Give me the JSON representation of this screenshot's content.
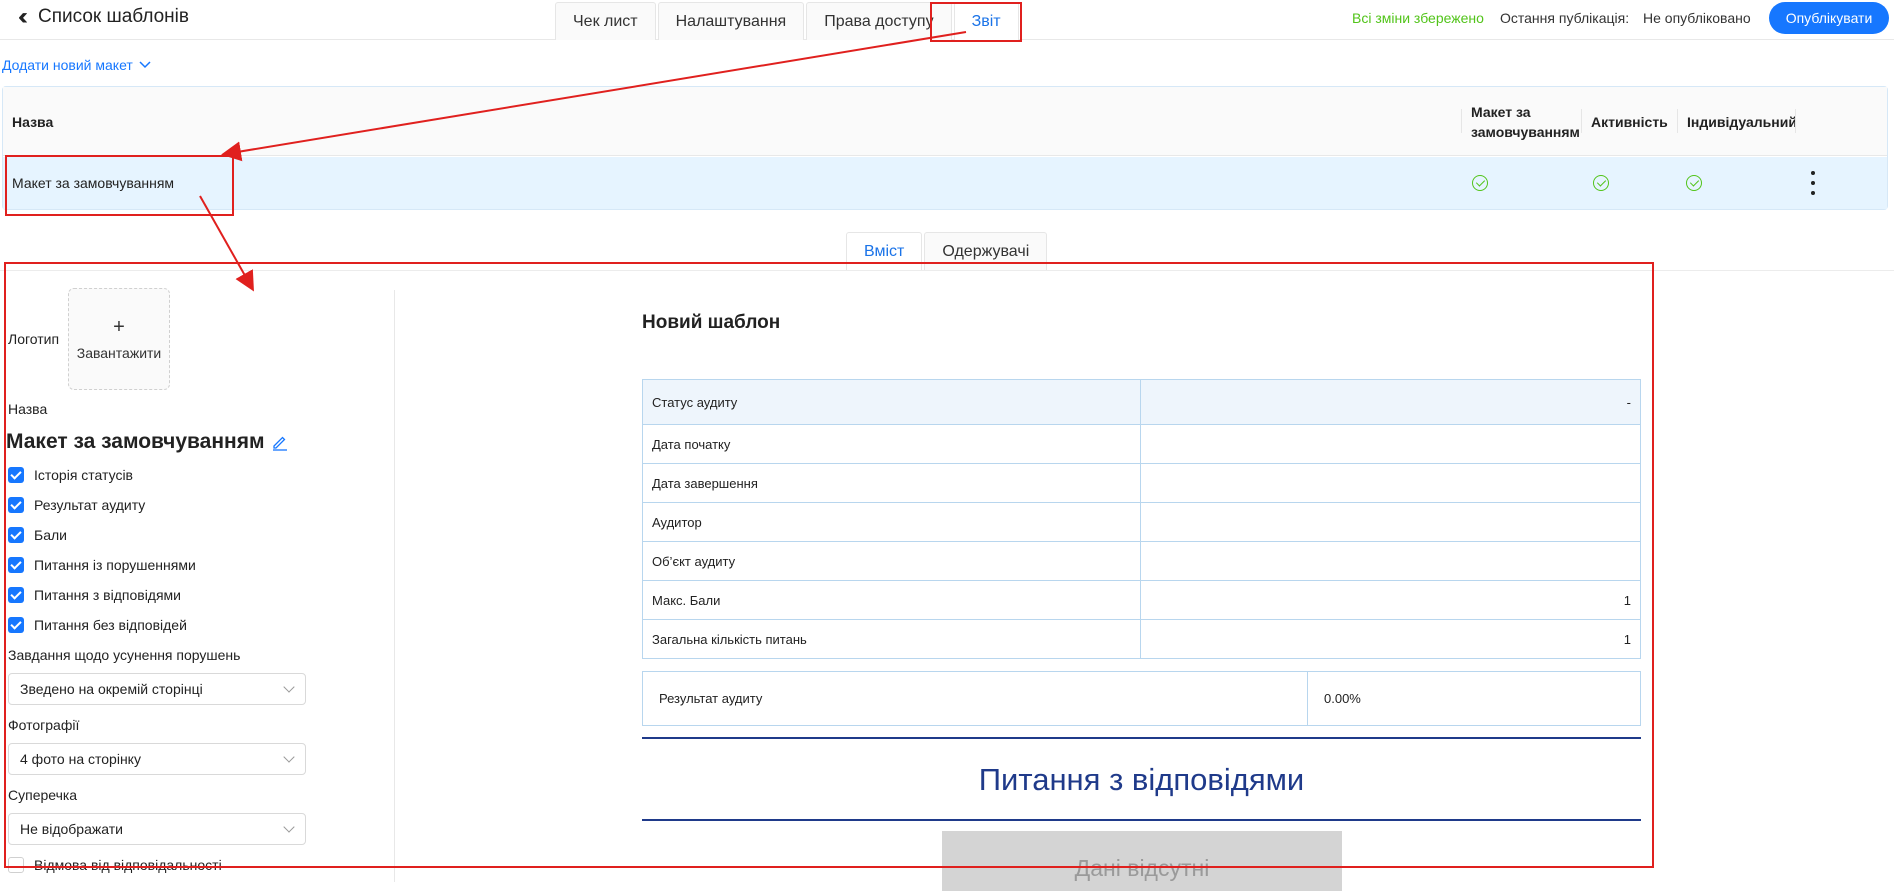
{
  "header": {
    "back_label": "Список шаблонів",
    "tabs": [
      {
        "label": "Чек лист"
      },
      {
        "label": "Налаштування"
      },
      {
        "label": "Права доступу"
      },
      {
        "label": "Звіт"
      }
    ],
    "saved_status": "Всі зміни збережено",
    "last_publication_label": "Остання публікація:",
    "last_publication_value": "Не опубліковано",
    "publish_button": "Опублікувати"
  },
  "add_layout": "Додати новий макет",
  "layouts_table": {
    "columns": [
      "Назва",
      "Макет за замовчуванням",
      "Активність",
      "Індивідуальний"
    ],
    "rows": [
      {
        "name": "Макет за замовчуванням",
        "default": true,
        "active": true,
        "individual": true
      }
    ]
  },
  "content_tabs": [
    {
      "label": "Вміст"
    },
    {
      "label": "Одержувачі"
    }
  ],
  "left_panel": {
    "logo_label": "Логотип",
    "upload_label": "Завантажити",
    "name_label": "Назва",
    "name_value": "Макет за замовчуванням",
    "checkboxes": [
      {
        "label": "Історія статусів",
        "checked": true
      },
      {
        "label": "Результат аудиту",
        "checked": true
      },
      {
        "label": "Бали",
        "checked": true
      },
      {
        "label": "Питання із порушеннями",
        "checked": true
      },
      {
        "label": "Питання з відповідями",
        "checked": true
      },
      {
        "label": "Питання без відповідей",
        "checked": true
      }
    ],
    "tasks_label": "Завдання щодо усунення порушень",
    "tasks_value": "Зведено на окремій сторінці",
    "photos_label": "Фотографії",
    "photos_value": "4 фото на сторінку",
    "dispute_label": "Суперечка",
    "dispute_value": "Не відображати",
    "disclaimer_label": "Відмова від відповідальності"
  },
  "report": {
    "title": "Новий шаблон",
    "rows": [
      {
        "label": "Статус аудиту",
        "value": "-"
      },
      {
        "label": "Дата початку",
        "value": ""
      },
      {
        "label": "Дата завершення",
        "value": ""
      },
      {
        "label": "Аудитор",
        "value": ""
      },
      {
        "label": "Об’єкт аудиту",
        "value": ""
      },
      {
        "label": "Макс. Бали",
        "value": "1"
      },
      {
        "label": "Загальна кількість питань",
        "value": "1"
      }
    ],
    "result_label": "Результат аудиту",
    "result_value": "0.00%",
    "section_title": "Питання з відповідями",
    "no_data": "Дані відсутні"
  },
  "colors": {
    "accent": "#1677ff",
    "success": "#52c41a",
    "annotation": "#e0201e",
    "section": "#1f3a8a"
  }
}
